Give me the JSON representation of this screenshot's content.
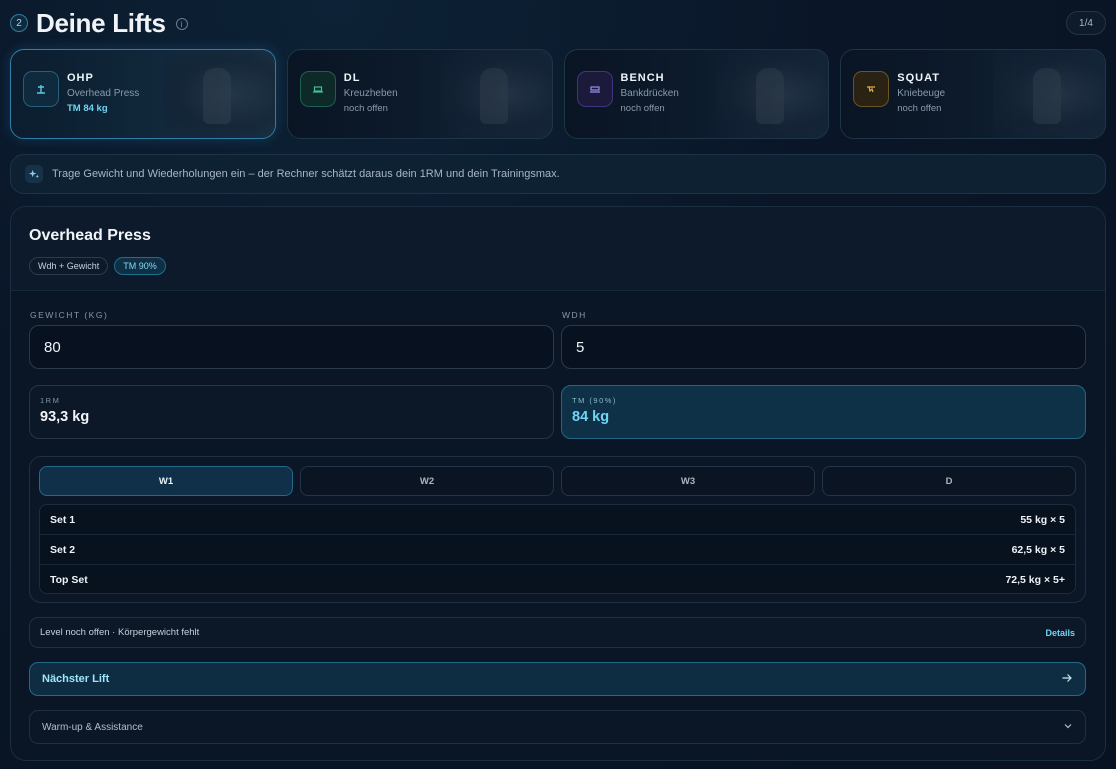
{
  "header": {
    "step": "2",
    "title": "Deine Lifts",
    "info_icon": "info-icon",
    "pager": "1/4"
  },
  "lifts": [
    {
      "abbr": "OHP",
      "name": "Overhead Press",
      "status": "TM 84 kg",
      "icon": "overhead-press-icon",
      "color": "#5fc6e6",
      "active": true
    },
    {
      "abbr": "DL",
      "name": "Kreuzheben",
      "status": "noch offen",
      "icon": "deadlift-icon",
      "color": "#3fbf98",
      "active": false
    },
    {
      "abbr": "BENCH",
      "name": "Bankdrücken",
      "status": "noch offen",
      "icon": "bench-icon",
      "color": "#9d8cf0",
      "active": false
    },
    {
      "abbr": "SQUAT",
      "name": "Kniebeuge",
      "status": "noch offen",
      "icon": "squat-icon",
      "color": "#e0b34c",
      "active": false
    }
  ],
  "banner": {
    "icon": "sparkle-icon",
    "text": "Trage Gewicht und Wiederholungen ein – der Rechner schätzt daraus dein 1RM und dein Trainingsmax."
  },
  "panel": {
    "title": "Overhead Press",
    "chips": [
      "Wdh + Gewicht",
      "TM 90%"
    ],
    "weight_label": "GEWICHT (KG)",
    "weight_value": "80",
    "reps_label": "WDH",
    "reps_value": "5",
    "one_rm_label": "1RM",
    "one_rm_value": "93,3 kg",
    "tm_label": "TM (90%)",
    "tm_value": "84 kg",
    "week_tabs": [
      "W1",
      "W2",
      "W3",
      "D"
    ],
    "active_week": "W1",
    "sets": [
      {
        "label": "Set 1",
        "value": "55 kg × 5"
      },
      {
        "label": "Set 2",
        "value": "62,5 kg × 5"
      },
      {
        "label": "Top Set",
        "value": "72,5 kg × 5+"
      }
    ],
    "level_text": "Level noch offen · Körpergewicht fehlt",
    "details_label": "Details",
    "next_label": "Nächster Lift",
    "next_icon": "arrow-right-icon",
    "warmup_label": "Warm-up & Assistance",
    "warmup_icon": "chevron-down-icon"
  }
}
